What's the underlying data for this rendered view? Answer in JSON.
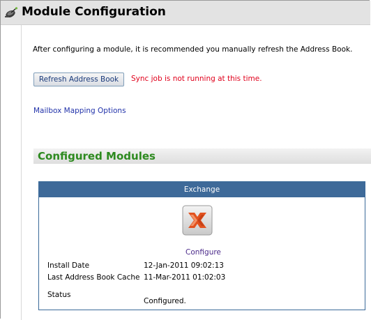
{
  "header": {
    "title": "Module Configuration",
    "icon": "satellite-dish-icon"
  },
  "intro_text": "After configuring a module, it is recommended you manually refresh the Address Book.",
  "refresh_button_label": "Refresh Address Book",
  "sync_status": "Sync job is not running at this time.",
  "mailbox_mapping_link": "Mailbox Mapping Options",
  "configured_modules": {
    "title": "Configured Modules",
    "modules": [
      {
        "name": "Exchange",
        "icon": "exchange-icon",
        "configure_label": "Configure",
        "install_date_label": "Install Date",
        "install_date": "12-Jan-2011 09:02:13",
        "last_cache_label": "Last Address Book Cache",
        "last_cache": "11-Mar-2011 01:02:03",
        "status_label": "Status",
        "status": "Configured."
      }
    ]
  },
  "colors": {
    "section_title": "#2d8a1f",
    "module_header": "#3e6a99",
    "sync_status": "#e0001b",
    "link": "#2233aa"
  }
}
